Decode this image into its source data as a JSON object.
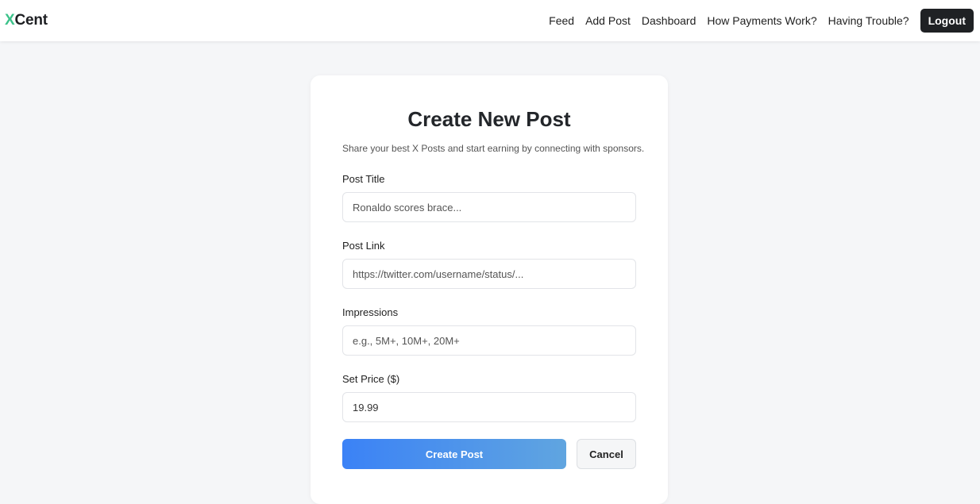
{
  "navbar": {
    "brand_x": "X",
    "brand_rest": "Cent",
    "links": [
      "Feed",
      "Add Post",
      "Dashboard",
      "How Payments Work?",
      "Having Trouble?"
    ],
    "logout_label": "Logout"
  },
  "form": {
    "title": "Create New Post",
    "subtitle": "Share your best X Posts and start earning by connecting with sponsors.",
    "fields": [
      {
        "label": "Post Title",
        "value": "",
        "placeholder": "Ronaldo scores brace..."
      },
      {
        "label": "Post Link",
        "value": "",
        "placeholder": "https://twitter.com/username/status/..."
      },
      {
        "label": "Impressions",
        "value": "",
        "placeholder": "e.g., 5M+, 10M+, 20M+"
      },
      {
        "label": "Set Price ($)",
        "value": "19.99",
        "placeholder": ""
      }
    ],
    "submit_label": "Create Post",
    "cancel_label": "Cancel"
  },
  "colors": {
    "brand_accent": "#3cc28a",
    "primary_gradient_start": "#3b82f6",
    "primary_gradient_end": "#60a5e0",
    "logout_bg": "#1f2124"
  }
}
